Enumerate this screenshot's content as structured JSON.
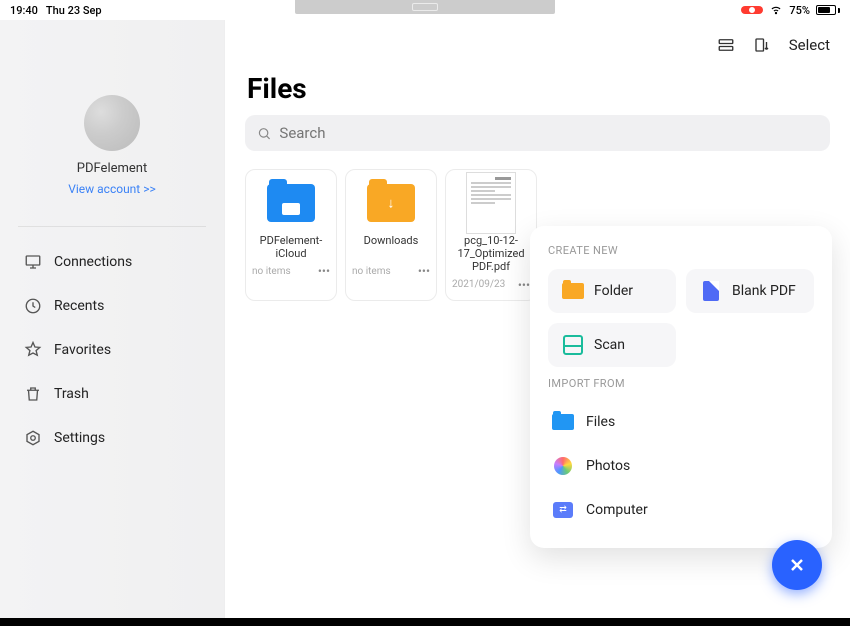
{
  "statusbar": {
    "time": "19:40",
    "date": "Thu 23 Sep",
    "battery_pct": "75%"
  },
  "topbar": {
    "select": "Select"
  },
  "sidebar": {
    "app_name": "PDFelement",
    "view_account": "View account >>",
    "items": [
      {
        "label": "Connections"
      },
      {
        "label": "Recents"
      },
      {
        "label": "Favorites"
      },
      {
        "label": "Trash"
      },
      {
        "label": "Settings"
      }
    ]
  },
  "main": {
    "title": "Files",
    "search_placeholder": "Search"
  },
  "files": [
    {
      "name": "PDFelement-iCloud",
      "meta": "no items"
    },
    {
      "name": "Downloads",
      "meta": "no items"
    },
    {
      "name": "pcg_10-12-17_Optimized PDF.pdf",
      "meta": "2021/09/23"
    }
  ],
  "popup": {
    "create_label": "CREATE NEW",
    "folder": "Folder",
    "blank_pdf": "Blank PDF",
    "scan": "Scan",
    "import_label": "IMPORT FROM",
    "files": "Files",
    "photos": "Photos",
    "computer": "Computer"
  }
}
